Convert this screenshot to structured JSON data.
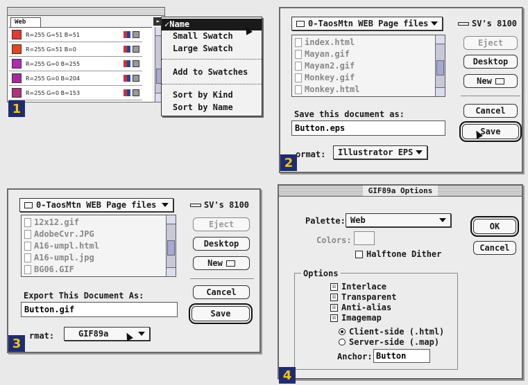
{
  "panel1": {
    "tab": "Web",
    "swatches": [
      {
        "label": "R=255 G=51 B=51",
        "color": "#e23a2e"
      },
      {
        "label": "R=255 G=51 B=0",
        "color": "#e2461a"
      },
      {
        "label": "R=255 G=0 B=255",
        "color": "#b02ab6"
      },
      {
        "label": "R=255 G=0 B=204",
        "color": "#a52a9c"
      },
      {
        "label": "R=255 G=0 B=153",
        "color": "#b0347c"
      }
    ],
    "menu": {
      "check": "✓",
      "items": [
        "Name",
        "Small Swatch",
        "Large Swatch",
        "Add to Swatches",
        "Sort by Kind",
        "Sort by Name"
      ]
    },
    "badge": "1"
  },
  "panel2": {
    "folder": "0-TaosMtn WEB Page files",
    "disk": "SV's 8100",
    "files": [
      "index.html",
      "Mayan.gif",
      "Mayan2.gif",
      "Monkey.gif",
      "Monkey.html"
    ],
    "buttons": {
      "eject": "Eject",
      "desktop": "Desktop",
      "new": "New",
      "cancel": "Cancel",
      "save": "Save"
    },
    "prompt": "Save this document as:",
    "filename": "Button.eps",
    "format_label": "ormat:",
    "format_value": "Illustrator EPS",
    "badge": "2"
  },
  "panel3": {
    "folder": "0-TaosMtn WEB Page files",
    "disk": "SV's 8100",
    "files": [
      "12x12.gif",
      "AdobeCvr.JPG",
      "A16-umpl.html",
      "A16-umpl.jpg",
      "BG06.GIF"
    ],
    "buttons": {
      "eject": "Eject",
      "desktop": "Desktop",
      "new": "New",
      "cancel": "Cancel",
      "save": "Save"
    },
    "prompt": "Export This Document As:",
    "filename": "Button.gif",
    "format_label": "rmat:",
    "format_value": "GIF89a",
    "badge": "3"
  },
  "panel4": {
    "title": "GIF89a Options",
    "palette_label": "Palette:",
    "palette_value": "Web",
    "colors_label": "Colors:",
    "halftone": "Halftone Dither",
    "ok": "OK",
    "cancel": "Cancel",
    "options_label": "Options",
    "checks": [
      "Interlace",
      "Transparent",
      "Anti-alias",
      "Imagemap"
    ],
    "radios": [
      "Client-side (.html)",
      "Server-side (.map)"
    ],
    "anchor_label": "Anchor:",
    "anchor_value": "Button",
    "badge": "4"
  },
  "colors": {
    "accent_badge": "#1f2d6e",
    "badge_text": "#f4c21a",
    "menu_highlight": "#1a1a1a"
  }
}
